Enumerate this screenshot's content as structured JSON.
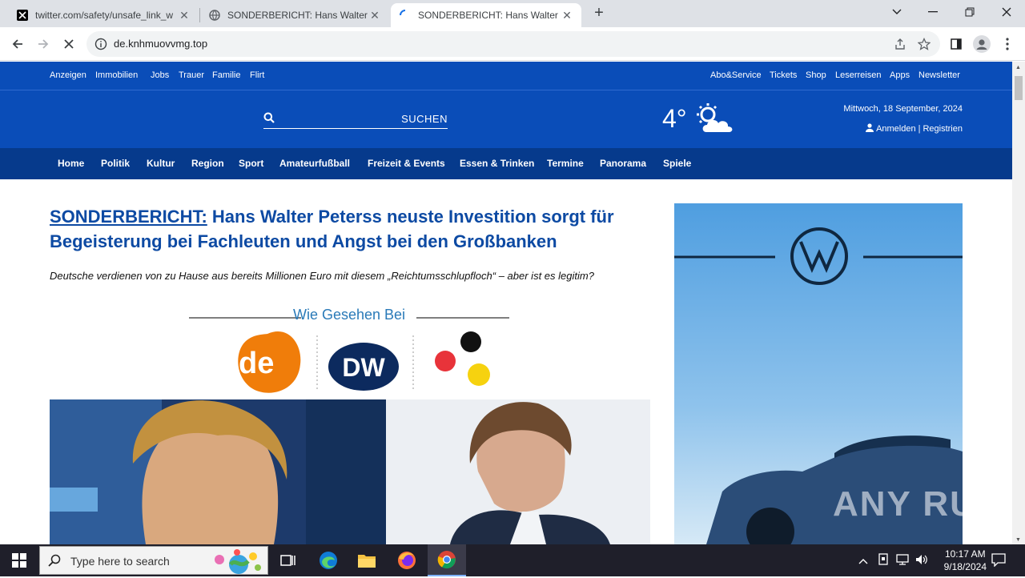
{
  "browser": {
    "tabs": [
      {
        "title": "twitter.com/safety/unsafe_link_w",
        "icon": "x-logo-icon"
      },
      {
        "title": "SONDERBERICHT: Hans Walter P",
        "icon": "globe-icon"
      },
      {
        "title": "SONDERBERICHT: Hans Walter P",
        "icon": "loading-spinner-icon"
      }
    ],
    "new_tab": "+",
    "url": "de.knhmuovvmg.top"
  },
  "site": {
    "top_links_left": [
      "Anzeigen",
      "Immobilien",
      "Jobs",
      "Trauer",
      "Familie",
      "Flirt"
    ],
    "top_links_right": [
      "Abo&Service",
      "Tickets",
      "Shop",
      "Leserreisen",
      "Apps",
      "Newsletter"
    ],
    "search_label": "SUCHEN",
    "temperature": "4°",
    "date": "Mittwoch, 18 September, 2024",
    "login": "Anmelden",
    "register": "Registrien",
    "nav": [
      "Home",
      "Politik",
      "Kultur",
      "Region",
      "Sport",
      "Amateurfußball",
      "Freizeit & Events",
      "Essen & Trinken",
      "Termine",
      "Panorama",
      "Spiele"
    ],
    "brand_color": "#0a4db8"
  },
  "article": {
    "kicker": "SONDERBERICHT:",
    "headline": " Hans Walter Peterss neuste Investition sorgt für Begeisterung bei Fachleuten und Angst bei den Großbanken",
    "subline": "Deutsche verdienen von zu Hause aus bereits Millionen Euro mit diesem „Reichtumsschlupfloch“ – aber ist es legitim?",
    "as_seen_title": "Wie Gesehen Bei",
    "logos": [
      "de",
      "DW"
    ]
  },
  "taskbar": {
    "search_placeholder": "Type here to search",
    "time": "10:17 AM",
    "date": "9/18/2024"
  },
  "watermark": "ANY RUN"
}
